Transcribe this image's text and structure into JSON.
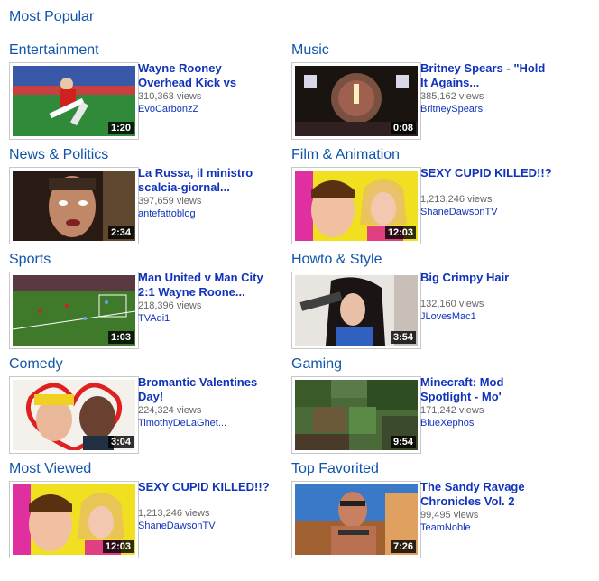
{
  "page": {
    "title": "Most Popular"
  },
  "categories": [
    {
      "heading": "Entertainment",
      "video": {
        "title_lines": [
          "Wayne Rooney",
          "Overhead Kick vs"
        ],
        "views": "310,363 views",
        "user": "EvoCarbonzZ",
        "duration": "1:20"
      }
    },
    {
      "heading": "Music",
      "video": {
        "title_lines": [
          "Britney Spears - \"Hold",
          "It Agains..."
        ],
        "views": "385,162 views",
        "user": "BritneySpears",
        "duration": "0:08"
      }
    },
    {
      "heading": "News & Politics",
      "video": {
        "title_lines": [
          "La Russa, il ministro",
          "scalcia-giornal..."
        ],
        "views": "397,659 views",
        "user": "antefattoblog",
        "duration": "2:34"
      }
    },
    {
      "heading": "Film & Animation",
      "video": {
        "title_lines": [
          "SEXY CUPID KILLED!!?",
          ""
        ],
        "views": "1,213,246 views",
        "user": "ShaneDawsonTV",
        "duration": "12:03"
      }
    },
    {
      "heading": "Sports",
      "video": {
        "title_lines": [
          "Man United v Man City",
          "2:1 Wayne Roone..."
        ],
        "views": "218,396 views",
        "user": "TVAdi1",
        "duration": "1:03"
      }
    },
    {
      "heading": "Howto & Style",
      "video": {
        "title_lines": [
          "Big Crimpy Hair",
          ""
        ],
        "views": "132,160 views",
        "user": "JLovesMac1",
        "duration": "3:54"
      }
    },
    {
      "heading": "Comedy",
      "video": {
        "title_lines": [
          "Bromantic Valentines",
          "Day!"
        ],
        "views": "224,324 views",
        "user": "TimothyDeLaGhet...",
        "duration": "3:04"
      }
    },
    {
      "heading": "Gaming",
      "video": {
        "title_lines": [
          "Minecraft: Mod",
          "Spotlight - Mo'"
        ],
        "views": "171,242 views",
        "user": "BlueXephos",
        "duration": "9:54"
      }
    },
    {
      "heading": "Most Viewed",
      "video": {
        "title_lines": [
          "SEXY CUPID KILLED!!?",
          ""
        ],
        "views": "1,213,246 views",
        "user": "ShaneDawsonTV",
        "duration": "12:03"
      }
    },
    {
      "heading": "Top Favorited",
      "video": {
        "title_lines": [
          "The Sandy Ravage",
          "Chronicles Vol. 2"
        ],
        "views": "99,495 views",
        "user": "TeamNoble",
        "duration": "7:26"
      }
    }
  ]
}
